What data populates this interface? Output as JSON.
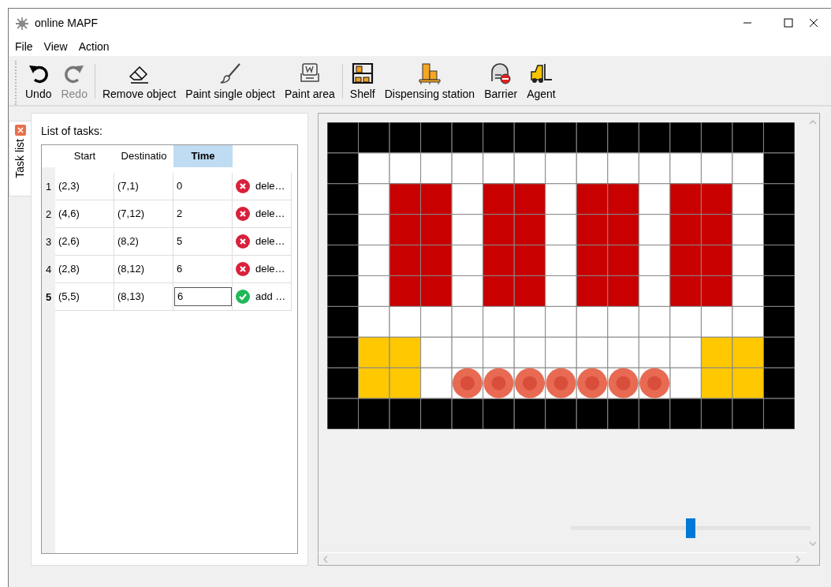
{
  "window": {
    "title": "online MAPF"
  },
  "menu": [
    "File",
    "View",
    "Action"
  ],
  "toolbar": {
    "groups": [
      [
        {
          "kind": "undo",
          "label": "Undo",
          "disabled": false
        },
        {
          "kind": "redo",
          "label": "Redo",
          "disabled": true
        }
      ],
      [
        {
          "kind": "eraser",
          "label": "Remove object",
          "disabled": false
        },
        {
          "kind": "brush",
          "label": "Paint single object",
          "disabled": false
        },
        {
          "kind": "area",
          "label": "Paint area",
          "disabled": false
        }
      ],
      [
        {
          "kind": "shelf",
          "label": "Shelf",
          "disabled": false
        },
        {
          "kind": "station",
          "label": "Dispensing station",
          "disabled": false
        },
        {
          "kind": "barrier",
          "label": "Barrier",
          "disabled": false
        },
        {
          "kind": "agent",
          "label": "Agent",
          "disabled": false
        }
      ]
    ]
  },
  "side_tab": {
    "label": "Task list"
  },
  "task_panel": {
    "title": "List of tasks:",
    "columns": [
      {
        "label": "Start",
        "selected": false
      },
      {
        "label": "Destinatio",
        "selected": false
      },
      {
        "label": "Time",
        "selected": true
      }
    ],
    "rows": [
      {
        "number": "1",
        "current": false,
        "start": "(2,3)",
        "destination": "(7,1)",
        "time": "0",
        "editing": false,
        "action": {
          "kind": "delete",
          "label": "dele…"
        }
      },
      {
        "number": "2",
        "current": false,
        "start": "(4,6)",
        "destination": "(7,12)",
        "time": "2",
        "editing": false,
        "action": {
          "kind": "delete",
          "label": "dele…"
        }
      },
      {
        "number": "3",
        "current": false,
        "start": "(2,6)",
        "destination": "(8,2)",
        "time": "5",
        "editing": false,
        "action": {
          "kind": "delete",
          "label": "dele…"
        }
      },
      {
        "number": "4",
        "current": false,
        "start": "(2,8)",
        "destination": "(8,12)",
        "time": "6",
        "editing": false,
        "action": {
          "kind": "delete",
          "label": "dele…"
        }
      },
      {
        "number": "5",
        "current": true,
        "start": "(5,5)",
        "destination": "(8,13)",
        "time": "6",
        "editing": true,
        "action": {
          "kind": "add",
          "label": "add …"
        }
      }
    ]
  },
  "map": {
    "rows": [
      [
        {
          "kind": "wall"
        },
        {
          "kind": "wall"
        },
        {
          "kind": "wall"
        },
        {
          "kind": "wall"
        },
        {
          "kind": "wall"
        },
        {
          "kind": "wall"
        },
        {
          "kind": "wall"
        },
        {
          "kind": "wall"
        },
        {
          "kind": "wall"
        },
        {
          "kind": "wall"
        },
        {
          "kind": "wall"
        },
        {
          "kind": "wall"
        },
        {
          "kind": "wall"
        },
        {
          "kind": "wall"
        },
        {
          "kind": "wall"
        }
      ],
      [
        {
          "kind": "wall"
        },
        {
          "kind": "floor"
        },
        {
          "kind": "floor"
        },
        {
          "kind": "floor"
        },
        {
          "kind": "floor"
        },
        {
          "kind": "floor"
        },
        {
          "kind": "floor"
        },
        {
          "kind": "floor"
        },
        {
          "kind": "floor"
        },
        {
          "kind": "floor"
        },
        {
          "kind": "floor"
        },
        {
          "kind": "floor"
        },
        {
          "kind": "floor"
        },
        {
          "kind": "floor"
        },
        {
          "kind": "wall"
        }
      ],
      [
        {
          "kind": "wall"
        },
        {
          "kind": "floor"
        },
        {
          "kind": "shelf"
        },
        {
          "kind": "shelf"
        },
        {
          "kind": "floor"
        },
        {
          "kind": "shelf"
        },
        {
          "kind": "shelf"
        },
        {
          "kind": "floor"
        },
        {
          "kind": "shelf"
        },
        {
          "kind": "shelf"
        },
        {
          "kind": "floor"
        },
        {
          "kind": "shelf"
        },
        {
          "kind": "shelf"
        },
        {
          "kind": "floor"
        },
        {
          "kind": "wall"
        }
      ],
      [
        {
          "kind": "wall"
        },
        {
          "kind": "floor"
        },
        {
          "kind": "shelf"
        },
        {
          "kind": "shelf"
        },
        {
          "kind": "floor"
        },
        {
          "kind": "shelf"
        },
        {
          "kind": "shelf"
        },
        {
          "kind": "floor"
        },
        {
          "kind": "shelf"
        },
        {
          "kind": "shelf"
        },
        {
          "kind": "floor"
        },
        {
          "kind": "shelf"
        },
        {
          "kind": "shelf"
        },
        {
          "kind": "floor"
        },
        {
          "kind": "wall"
        }
      ],
      [
        {
          "kind": "wall"
        },
        {
          "kind": "floor"
        },
        {
          "kind": "shelf"
        },
        {
          "kind": "shelf"
        },
        {
          "kind": "floor"
        },
        {
          "kind": "shelf"
        },
        {
          "kind": "shelf"
        },
        {
          "kind": "floor"
        },
        {
          "kind": "shelf"
        },
        {
          "kind": "shelf"
        },
        {
          "kind": "floor"
        },
        {
          "kind": "shelf"
        },
        {
          "kind": "shelf"
        },
        {
          "kind": "floor"
        },
        {
          "kind": "wall"
        }
      ],
      [
        {
          "kind": "wall"
        },
        {
          "kind": "floor"
        },
        {
          "kind": "shelf"
        },
        {
          "kind": "shelf"
        },
        {
          "kind": "floor"
        },
        {
          "kind": "shelf"
        },
        {
          "kind": "shelf"
        },
        {
          "kind": "floor"
        },
        {
          "kind": "shelf"
        },
        {
          "kind": "shelf"
        },
        {
          "kind": "floor"
        },
        {
          "kind": "shelf"
        },
        {
          "kind": "shelf"
        },
        {
          "kind": "floor"
        },
        {
          "kind": "wall"
        }
      ],
      [
        {
          "kind": "wall"
        },
        {
          "kind": "floor"
        },
        {
          "kind": "floor"
        },
        {
          "kind": "floor"
        },
        {
          "kind": "floor"
        },
        {
          "kind": "floor"
        },
        {
          "kind": "floor"
        },
        {
          "kind": "floor"
        },
        {
          "kind": "floor"
        },
        {
          "kind": "floor"
        },
        {
          "kind": "floor"
        },
        {
          "kind": "floor"
        },
        {
          "kind": "floor"
        },
        {
          "kind": "floor"
        },
        {
          "kind": "wall"
        }
      ],
      [
        {
          "kind": "wall"
        },
        {
          "kind": "station"
        },
        {
          "kind": "station"
        },
        {
          "kind": "floor"
        },
        {
          "kind": "floor"
        },
        {
          "kind": "floor"
        },
        {
          "kind": "floor"
        },
        {
          "kind": "floor"
        },
        {
          "kind": "floor"
        },
        {
          "kind": "floor"
        },
        {
          "kind": "floor"
        },
        {
          "kind": "floor"
        },
        {
          "kind": "station"
        },
        {
          "kind": "station"
        },
        {
          "kind": "wall"
        }
      ],
      [
        {
          "kind": "wall"
        },
        {
          "kind": "station"
        },
        {
          "kind": "station"
        },
        {
          "kind": "floor"
        },
        {
          "kind": "agent"
        },
        {
          "kind": "agent"
        },
        {
          "kind": "agent"
        },
        {
          "kind": "agent"
        },
        {
          "kind": "agent"
        },
        {
          "kind": "agent"
        },
        {
          "kind": "agent"
        },
        {
          "kind": "floor"
        },
        {
          "kind": "station"
        },
        {
          "kind": "station"
        },
        {
          "kind": "wall"
        }
      ],
      [
        {
          "kind": "wall"
        },
        {
          "kind": "wall"
        },
        {
          "kind": "wall"
        },
        {
          "kind": "wall"
        },
        {
          "kind": "wall"
        },
        {
          "kind": "wall"
        },
        {
          "kind": "wall"
        },
        {
          "kind": "wall"
        },
        {
          "kind": "wall"
        },
        {
          "kind": "wall"
        },
        {
          "kind": "wall"
        },
        {
          "kind": "wall"
        },
        {
          "kind": "wall"
        },
        {
          "kind": "wall"
        },
        {
          "kind": "wall"
        }
      ]
    ]
  },
  "zoom_slider": {
    "level": 0.5
  }
}
